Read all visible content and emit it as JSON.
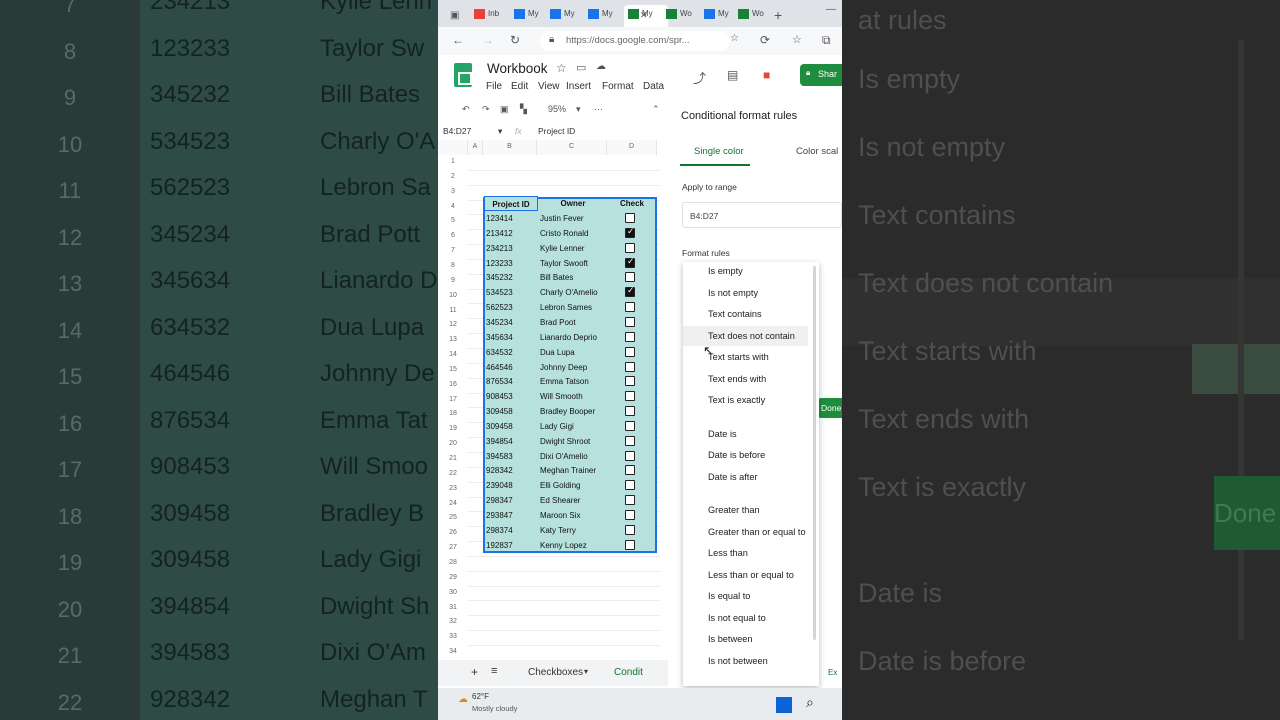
{
  "background_left": {
    "row_numbers": [
      "7",
      "8",
      "9",
      "10",
      "11",
      "12",
      "13",
      "14",
      "15",
      "16",
      "17",
      "18",
      "19",
      "20",
      "21",
      "22"
    ],
    "ids": [
      "234213",
      "123233",
      "345232",
      "534523",
      "562523",
      "345234",
      "345634",
      "634532",
      "464546",
      "876534",
      "908453",
      "309458",
      "309458",
      "394854",
      "394583",
      "928342"
    ],
    "owners": [
      "Kylie Lenn",
      "Taylor Sw",
      "Bill Bates",
      "Charly O'A",
      "Lebron Sa",
      "Brad Pott",
      "Lianardo D",
      "Dua Lupa",
      "Johnny De",
      "Emma Tat",
      "Will Smoo",
      "Bradley B",
      "Lady Gigi",
      "Dwight Sh",
      "Dixi O'Am",
      "Meghan T"
    ]
  },
  "background_right": {
    "items": [
      "at rules",
      "Is empty",
      "Is not empty",
      "Text contains",
      "Text does not contain",
      "Text starts with",
      "Text ends with",
      "Text is exactly",
      "Date is",
      "Date is before"
    ],
    "done": "Done"
  },
  "browser": {
    "tabs": [
      "Inb",
      "My",
      "My",
      "My",
      "My",
      "Wo",
      "My",
      "Wo"
    ],
    "url": "https://docs.google.com/spr...",
    "close": "✕",
    "new_tab": "+",
    "minimize": "—"
  },
  "sheet": {
    "title": "Workbook",
    "menu": [
      "File",
      "Edit",
      "View",
      "Insert",
      "Format",
      "Data"
    ],
    "zoom": "95%",
    "name_box": "B4:D27",
    "formula": "Project ID",
    "fx": "fx",
    "columns": [
      "A",
      "B",
      "C",
      "D"
    ],
    "row_numbers": [
      "1",
      "2",
      "3",
      "4",
      "5",
      "6",
      "7",
      "8",
      "9",
      "10",
      "11",
      "12",
      "13",
      "14",
      "15",
      "16",
      "17",
      "18",
      "19",
      "20",
      "21",
      "22",
      "23",
      "24",
      "25",
      "26",
      "27",
      "28",
      "29",
      "30",
      "31",
      "32",
      "33",
      "34"
    ],
    "headers": {
      "id": "Project ID",
      "owner": "Owner",
      "check": "Check"
    },
    "rows": [
      {
        "id": "123414",
        "owner": "Justin Fever",
        "checked": false
      },
      {
        "id": "213412",
        "owner": "Cristo Ronald",
        "checked": true
      },
      {
        "id": "234213",
        "owner": "Kylie Lenner",
        "checked": false
      },
      {
        "id": "123233",
        "owner": "Taylor Swooft",
        "checked": true
      },
      {
        "id": "345232",
        "owner": "Bill Bates",
        "checked": false
      },
      {
        "id": "534523",
        "owner": "Charly O'Amelio",
        "checked": true
      },
      {
        "id": "562523",
        "owner": "Lebron Sames",
        "checked": false
      },
      {
        "id": "345234",
        "owner": "Brad Poot",
        "checked": false
      },
      {
        "id": "345634",
        "owner": "Lianardo Deprio",
        "checked": false
      },
      {
        "id": "634532",
        "owner": "Dua Lupa",
        "checked": false
      },
      {
        "id": "464546",
        "owner": "Johnny Deep",
        "checked": false
      },
      {
        "id": "876534",
        "owner": "Emma Tatson",
        "checked": false
      },
      {
        "id": "908453",
        "owner": "Will Smooth",
        "checked": false
      },
      {
        "id": "309458",
        "owner": "Bradley Booper",
        "checked": false
      },
      {
        "id": "309458",
        "owner": "Lady Gigi",
        "checked": false
      },
      {
        "id": "394854",
        "owner": "Dwight Shroot",
        "checked": false
      },
      {
        "id": "394583",
        "owner": "Dixi O'Amelio",
        "checked": false
      },
      {
        "id": "928342",
        "owner": "Meghan Trainer",
        "checked": false
      },
      {
        "id": "239048",
        "owner": "Elli Golding",
        "checked": false
      },
      {
        "id": "298347",
        "owner": "Ed Shearer",
        "checked": false
      },
      {
        "id": "293847",
        "owner": "Maroon Six",
        "checked": false
      },
      {
        "id": "298374",
        "owner": "Katy Terry",
        "checked": false
      },
      {
        "id": "192837",
        "owner": "Kenny Lopez",
        "checked": false
      }
    ],
    "bottom_tabs": {
      "add": "+",
      "list": "≡",
      "checkboxes": "Checkboxes",
      "condit": "Condit"
    }
  },
  "panel": {
    "share": "Shar",
    "title": "Conditional format rules",
    "tab_single": "Single color",
    "tab_scale": "Color scal",
    "apply_label": "Apply to range",
    "range": "B4:D27",
    "rules_label": "Format rules",
    "done": "Done",
    "ex": "Ex"
  },
  "dropdown": {
    "items": [
      "Is empty",
      "Is not empty",
      "Text contains",
      "Text does not contain",
      "Text starts with",
      "Text ends with",
      "Text is exactly",
      "Date is",
      "Date is before",
      "Date is after",
      "Greater than",
      "Greater than or equal to",
      "Less than",
      "Less than or equal to",
      "Is equal to",
      "Is not equal to",
      "Is between",
      "Is not between"
    ],
    "highlighted_index": 3
  },
  "taskbar": {
    "temp": "62°F",
    "weather": "Mostly cloudy"
  }
}
